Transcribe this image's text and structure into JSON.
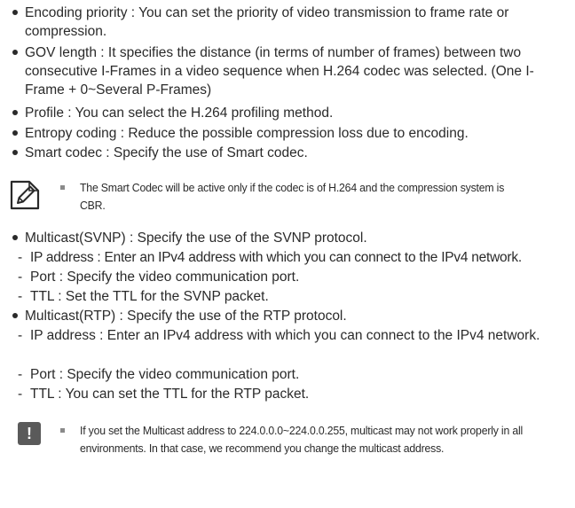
{
  "bullets_top": [
    {
      "label": "Encoding priority : You can set the priority of video transmission to frame rate or compression."
    },
    {
      "label": "GOV length : It specifies the distance (in terms of number of frames) between two consecutive I-Frames in a video sequence when H.264 codec was selected. (One I-Frame + 0~Several P-Frames)"
    },
    {
      "label": "Profile : You can select the H.264 profiling method."
    },
    {
      "label": "Entropy coding : Reduce the possible compression loss due to encoding."
    },
    {
      "label": "Smart codec : Specify the use of Smart codec."
    }
  ],
  "note": {
    "icon": "note-pencil-icon",
    "text": "The Smart Codec will be active only if the codec is of H.264 and the compression system is CBR."
  },
  "multicast_svnp": {
    "label": "Multicast(SVNP) : Specify the use of the SVNP protocol.",
    "items": [
      "IP address : Enter an IPv4 address with which you can connect to the IPv4 network.",
      "Port : Specify the video communication port.",
      "TTL : Set the TTL for the SVNP packet."
    ]
  },
  "multicast_rtp": {
    "label": "Multicast(RTP) : Specify the use of the RTP protocol.",
    "items": [
      "IP address : Enter an IPv4 address with which you can connect to the IPv4 network.",
      "Port : Specify the video communication port.",
      "TTL : You can set the TTL for the RTP packet."
    ]
  },
  "caution": {
    "icon": "caution-exclamation-icon",
    "symbol": "!",
    "text": "If you set the Multicast address to 224.0.0.0~224.0.0.255, multicast may not work properly in all environments. In that case, we recommend you change the multicast address."
  }
}
